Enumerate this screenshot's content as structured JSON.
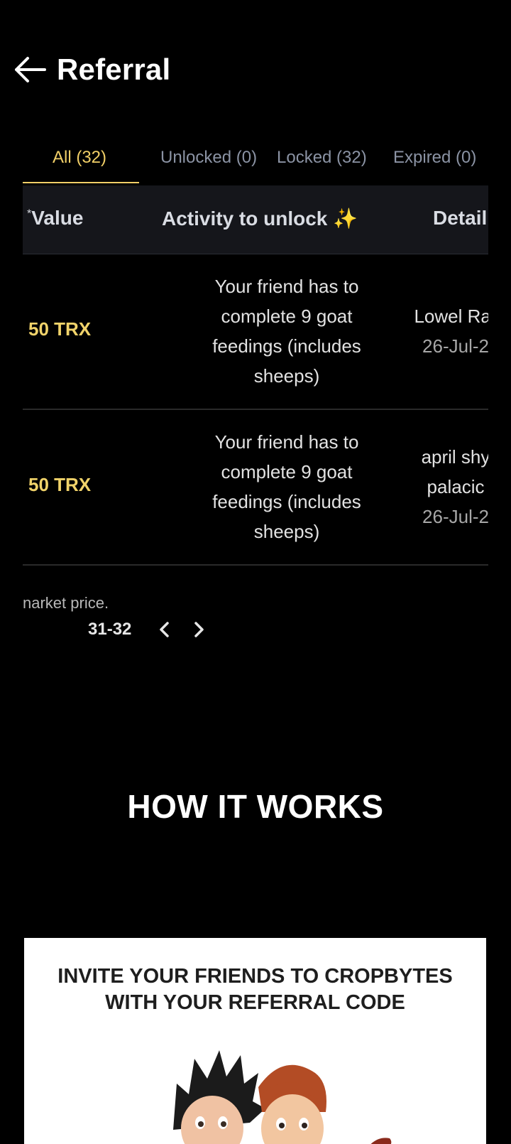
{
  "header": {
    "title": "Referral",
    "back_icon": "back-arrow-icon"
  },
  "tabs": [
    {
      "label": "All (32)",
      "active": true
    },
    {
      "label": "Unlocked (0)"
    },
    {
      "label": "Locked (32)"
    },
    {
      "label": "Expired (0)"
    }
  ],
  "table": {
    "headers": {
      "star": "*",
      "value": "Value",
      "activity": "Activity to unlock",
      "sparkle": "✨",
      "details": "Detail"
    },
    "rows": [
      {
        "value": "50 TRX",
        "activity_lines": [
          "Your friend has to",
          "complete 9 goat",
          "feedings (includes",
          "sheeps)"
        ],
        "detail_lines": [
          "Lowel Rar"
        ],
        "date": "26-Jul-2"
      },
      {
        "value": "50 TRX",
        "activity_lines": [
          "Your friend has to",
          "complete 9 goat",
          "feedings (includes",
          "sheeps)"
        ],
        "detail_lines": [
          "april shy",
          "palacic"
        ],
        "date": "26-Jul-2"
      }
    ]
  },
  "footer_note": "narket price.",
  "pagination": {
    "range": "31-32"
  },
  "how_it_works": {
    "title": "HOW IT WORKS"
  },
  "card": {
    "lines": [
      "INVITE YOUR FRIENDS TO CROPBYTES",
      "WITH YOUR REFERRAL CODE"
    ]
  },
  "colors": {
    "accent": "#f1cf67",
    "tab_inactive": "#8b93a4",
    "background": "#000000"
  }
}
